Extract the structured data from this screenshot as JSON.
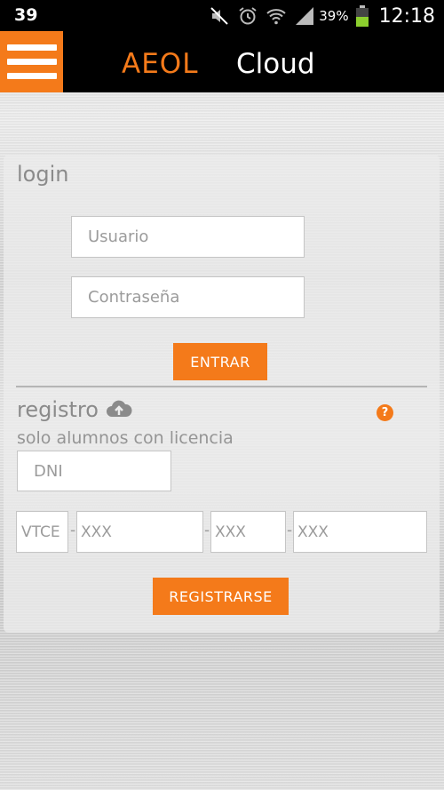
{
  "status_bar": {
    "notification_count": "39",
    "battery_percent": "39%",
    "time": "12:18",
    "icons": [
      "mute-icon",
      "alarm-icon",
      "wifi-icon",
      "signal-icon",
      "battery-icon"
    ]
  },
  "app_bar": {
    "brand": "AEOL",
    "title": "Cloud",
    "menu_icon": "hamburger-menu-icon"
  },
  "login": {
    "heading": "login",
    "username_placeholder": "Usuario",
    "password_placeholder": "Contraseña",
    "enter_label": "ENTRAR"
  },
  "register": {
    "heading": "registro",
    "subtitle": "solo alumnos con licencia",
    "help_glyph": "?",
    "dni_placeholder": "DNI",
    "code_prefix": "VTCE",
    "code_part1_placeholder": "XXX",
    "code_part2_placeholder": "XXX",
    "code_part3_placeholder": "XXX",
    "separator": "-",
    "register_label": "REGISTRARSE"
  },
  "colors": {
    "accent": "#f47a1a",
    "bar": "#000000",
    "heading_text": "#8b8b8b"
  }
}
